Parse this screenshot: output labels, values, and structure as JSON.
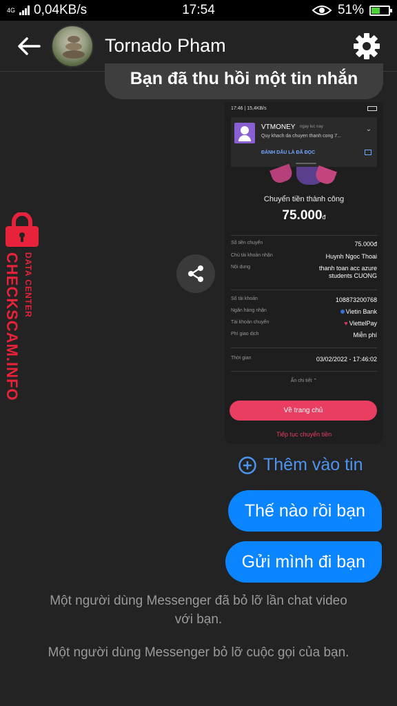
{
  "status_bar": {
    "network_type": "4G",
    "speed": "0,04KB/s",
    "time": "17:54",
    "battery": "51%",
    "battery_level": 0.51,
    "accent_battery_color": "#4cd137"
  },
  "header": {
    "back_icon": "arrow-left-icon",
    "contact_name": "Tornado Pham",
    "settings_icon": "gear-icon"
  },
  "messages": {
    "recalled": "Bạn đã thu hồi một tin nhắn",
    "screenshot": {
      "status_left": "17:46 | 15,4KB/s",
      "notification": {
        "app": "VTMONEY",
        "time": "ngay luc nay",
        "text": "Quy khach da chuyen thanh cong 7...",
        "action": "ĐÁNH DẤU LÀ ĐÃ ĐỌC"
      },
      "title": "Chuyển tiền thành công",
      "amount": "75.000",
      "amount_unit": "đ",
      "rows": [
        {
          "label": "Số tiền chuyển",
          "value": "75.000đ"
        },
        {
          "label": "Chủ tài khoản nhận",
          "value": "Huynh Ngoc Thoai"
        },
        {
          "label": "Nội dung",
          "value_line1": "thanh toan acc azure",
          "value_line2": "students  CUONG"
        },
        {
          "label": "Số tài khoản",
          "value": "108873200768"
        },
        {
          "label": "Ngân hàng nhận",
          "value": "Vietin Bank"
        },
        {
          "label": "Tài khoản chuyển",
          "value": "ViettelPay"
        },
        {
          "label": "Phí giao dịch",
          "value": "Miễn phí"
        },
        {
          "label": "Thời gian",
          "value": "03/02/2022 - 17:46:02"
        }
      ],
      "collapse": "Ẩn chi tiết",
      "home_button": "Về trang chủ",
      "continue_link": "Tiếp tục chuyển tiền"
    },
    "share_icon": "share-icon",
    "add_story": "Thêm vào tin",
    "outgoing": [
      "Thế nào rồi bạn",
      "Gửi mình đi bạn"
    ],
    "system": [
      "Một người dùng Messenger đã bỏ lỡ lần chat video với bạn.",
      "Một người dùng Messenger bỏ lỡ cuộc gọi của bạn."
    ]
  },
  "watermark": {
    "main": "CHECKSCAM.INFO",
    "sub": "DATA CENTER",
    "color": "#e8223a"
  },
  "colors": {
    "background": "#232323",
    "outgoing_bubble": "#0a84ff",
    "link": "#4d94f0"
  }
}
